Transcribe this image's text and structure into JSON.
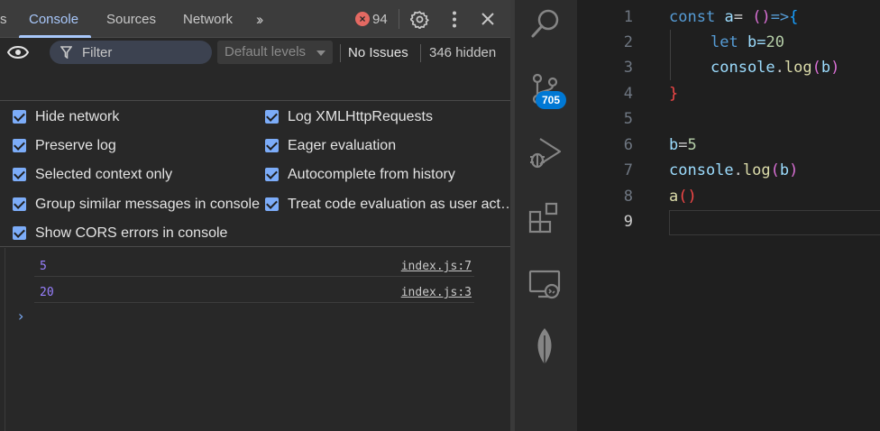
{
  "devtools": {
    "tabs": [
      "s",
      "Console",
      "Sources",
      "Network"
    ],
    "active_tab": "Console",
    "error_count": "94",
    "toolbar": {
      "filter_placeholder": "Filter",
      "levels_label": "Default levels",
      "issues_label": "No Issues",
      "hidden_label": "346 hidden"
    },
    "settings": {
      "left": [
        "Hide network",
        "Preserve log",
        "Selected context only",
        "Group similar messages in console",
        "Show CORS errors in console"
      ],
      "right": [
        "Log XMLHttpRequests",
        "Eager evaluation",
        "Autocomplete from history",
        "Treat code evaluation as user act…"
      ]
    },
    "messages": [
      {
        "value": "5",
        "source": "index.js:7"
      },
      {
        "value": "20",
        "source": "index.js:3"
      }
    ],
    "prompt": "›"
  },
  "vscode": {
    "scm_badge": "705",
    "line_numbers": [
      "1",
      "2",
      "3",
      "4",
      "5",
      "6",
      "7",
      "8",
      "9"
    ],
    "code": {
      "l1": {
        "kw": "const",
        "var": "a",
        "eq": "=",
        "p1": "(",
        "p2": ")",
        "arrow": "=>",
        "brace": "{"
      },
      "l2": {
        "kw": "let",
        "assign": "b=",
        "num": "20"
      },
      "l3": {
        "obj": "console",
        "dot": ".",
        "fn": "log",
        "p1": "(",
        "arg": "b",
        "p2": ")"
      },
      "l4": {
        "brace": "}"
      },
      "l6": {
        "var": "b",
        "eq": "=",
        "num": "5"
      },
      "l7": {
        "obj": "console",
        "dot": ".",
        "fn": "log",
        "p1": "(",
        "arg": "b",
        "p2": ")"
      },
      "l8": {
        "fn": "a",
        "p1": "(",
        "p2": ")"
      }
    }
  },
  "colors": {
    "accent": "#a8c7fa",
    "checkbox": "#7cacf8",
    "error": "#e46962",
    "console_value": "#9980ff",
    "badge": "#0078d4"
  },
  "icons": [
    "more-tabs-icon",
    "error-icon",
    "gear-icon",
    "kebab-icon",
    "close-icon",
    "eye-icon",
    "filter-icon",
    "search-icon",
    "source-control-icon",
    "run-debug-icon",
    "extensions-icon",
    "remote-explorer-icon",
    "leaf-icon"
  ]
}
